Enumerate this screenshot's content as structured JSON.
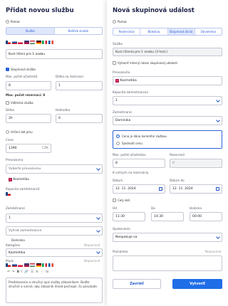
{
  "left": {
    "title": "Přidat novou službu",
    "back_label": "Pomoc",
    "tabs": [
      "Služba",
      "Balíček služeb"
    ],
    "service_name": "Kurz líčení pro 1 osobu",
    "group_checkbox": "Skupinová služba",
    "max_people_label": "Max. počet účastníků",
    "max_people_value": "8",
    "capacity_label": "Délka na rezervaci",
    "capacity_value": "1",
    "max_people_hint": "Max. počet rezervací: 8",
    "hidden_checkbox": "Viditelná služba",
    "duration_label": "Délka",
    "duration_value": "2h",
    "break_label": "Hodnotka",
    "break_value": "0",
    "deposit_checkbox": "Určení dat plnu",
    "price_label": "Cena",
    "price_value": "1390",
    "currency": "CZK",
    "category_label": "Prevozovna",
    "category_placeholder": "Vyberte prevozovnu",
    "category_tag": "Kozmetika",
    "staff_count_label": "Kapacita zaměstnanců",
    "staff_count_value": "1",
    "staff_label": "Zaměstnanci",
    "staff_placeholder": "Vyhrat zamestnance",
    "staff_tag": "Dominika",
    "cat2_label": "Kategórie",
    "cat2_optional": "Nepovinné",
    "cat2_value": "Kozmetika",
    "desc_label": "Popis",
    "desc_optional": "Nepovinné",
    "desc_text": "Predstavenie a stručný opis služby zákazníkom. Buďte stručné a vecné, aby zákazník ihned pochopil, čo ponúkate."
  },
  "right": {
    "title": "Nová skupinová událost",
    "back_label": "Pomoc",
    "tabs": [
      "Rezervácia",
      "Blokácia",
      "Skupinová akcia",
      "Dovolenka"
    ],
    "active_tab": 2,
    "service_label": "Služba",
    "service_value": "Kurz líčenia pre 1 osobu (3 hod.)",
    "internal_checkbox": "Vytvoriť interný názov skupinovej udalosti",
    "location_label": "Prevozovňa",
    "location_value": "Kozmetika",
    "staff_cap_label": "Kapacita zamestnancov",
    "staff_cap_value": "1",
    "staff_label": "Zamestnanci",
    "staff_value": "Dominika",
    "price_option1": "Cena je dána konkrétní službou",
    "price_option2": "Sjednotit cenu",
    "max_people_label": "Max. počet účastníkov",
    "max_people_value": "8",
    "reserved_label": "Rezervácií",
    "reserved_value": "0",
    "slots_hint": "8 voľných na rezerváciu",
    "date_from_label": "Dátum",
    "date_from": "12. 11. 2024",
    "date_to_label": "Dátum do",
    "date_to": "12. 11. 2024",
    "all_day": "Celý deň",
    "from_label": "Od",
    "from_value": "11:30",
    "to_label": "Do",
    "to_value": "14:30",
    "duration_label": "Hodzina",
    "duration_value": "00:00",
    "repeat_label": "Opakovanie",
    "repeat_value": "Neopakuje sa",
    "note_label": "Poznámka",
    "note_optional": "Nepovinné",
    "cancel_label": "Zavrieť",
    "create_label": "Vytvoriť"
  },
  "colors": {
    "primary": "#1f6ee8",
    "tag": "#e9336a",
    "border": "#c4c8d2"
  }
}
